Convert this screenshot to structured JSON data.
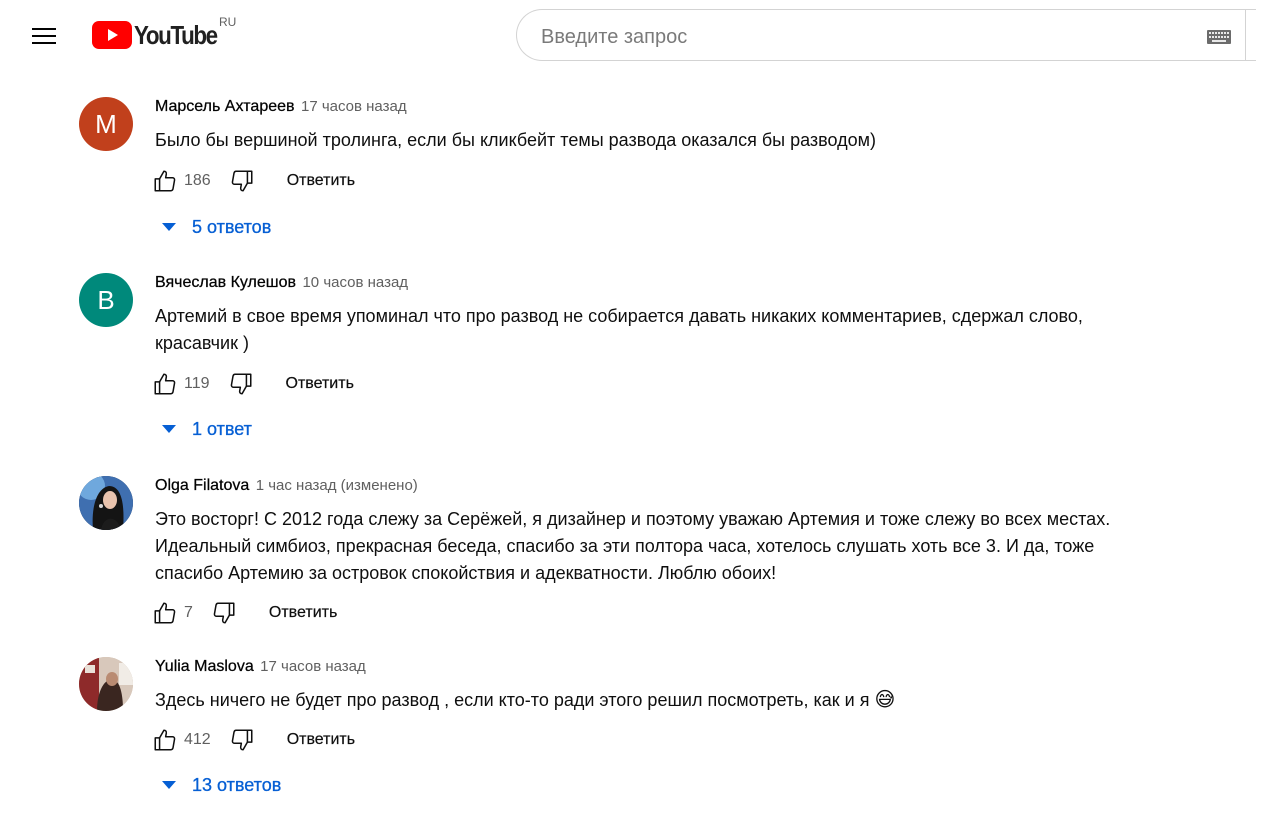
{
  "header": {
    "logo_text": "YouTube",
    "region": "RU",
    "search_placeholder": "Введите запрос",
    "brand_color": "#ff0000"
  },
  "comments": [
    {
      "author": "Марсель Ахтареев",
      "time": "17 часов назад",
      "text": "Было бы вершиной тролинга, если бы кликбейт темы развода оказался бы разводом)",
      "likes": "186",
      "reply_label": "Ответить",
      "replies_label": "5 ответов",
      "avatar_letter": "М",
      "avatar_color": "#c1401c"
    },
    {
      "author": "Вячеслав Кулешов",
      "time": "10 часов назад",
      "text_lines": [
        "Артемий в свое время упоминал что про развод не собирается давать никаких комментариев, сдержал слово,",
        "красавчик )"
      ],
      "likes": "119",
      "reply_label": "Ответить",
      "replies_label": "1 ответ",
      "avatar_letter": "В",
      "avatar_color": "#00897b"
    },
    {
      "author": "Olga Filatova",
      "time": "1 час назад (изменено)",
      "text_lines": [
        "Это восторг! С 2012 года слежу за Серёжей, я дизайнер и поэтому уважаю Артемия и тоже слежу во всех местах.",
        "Идеальный симбиоз, прекрасная беседа, спасибо за эти полтора часа, хотелось слушать хоть все 3. И да, тоже",
        "спасибо Артемию за островок спокойствия и адекватности. Люблю обоих!"
      ],
      "likes": "7",
      "reply_label": "Ответить",
      "avatar_icon": "profile-photo"
    },
    {
      "author": "Yulia Maslova",
      "time": "17 часов назад",
      "text": "Здесь ничего не будет про развод , если кто-то ради этого решил посмотреть, как и я",
      "emoji": "😅",
      "likes": "412",
      "reply_label": "Ответить",
      "replies_label": "13 ответов",
      "avatar_icon": "profile-photo"
    }
  ],
  "colors": {
    "link_blue": "#065fd4",
    "secondary_text": "#606060"
  }
}
